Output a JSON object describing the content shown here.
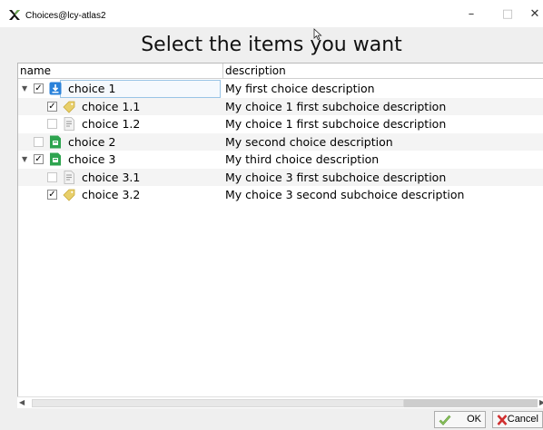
{
  "window": {
    "title": "Choices@lcy-atlas2",
    "min_glyph": "–",
    "max_glyph": "□",
    "close_glyph": "✕"
  },
  "heading": "Select the items you want",
  "columns": {
    "name": "name",
    "description": "description"
  },
  "rows": [
    {
      "name": "choice 1",
      "description": "My first choice description",
      "checked": true,
      "level": 0,
      "expandable": true,
      "icon": "download-icon",
      "selected": true
    },
    {
      "name": "choice 1.1",
      "description": "My choice 1 first subchoice description",
      "checked": true,
      "level": 1,
      "expandable": false,
      "icon": "tag-icon"
    },
    {
      "name": "choice 1.2",
      "description": "My choice 1 first subchoice description",
      "checked": false,
      "level": 1,
      "expandable": false,
      "icon": "document-icon"
    },
    {
      "name": "choice 2",
      "description": "My second choice description",
      "checked": false,
      "level": 0,
      "expandable": false,
      "icon": "green-file-icon"
    },
    {
      "name": "choice 3",
      "description": "My third choice description",
      "checked": true,
      "level": 0,
      "expandable": true,
      "icon": "green-file-icon"
    },
    {
      "name": "choice 3.1",
      "description": "My choice 3 first subchoice description",
      "checked": false,
      "level": 1,
      "expandable": false,
      "icon": "document-icon"
    },
    {
      "name": "choice 3.2",
      "description": "My choice 3 second subchoice description",
      "checked": true,
      "level": 1,
      "expandable": false,
      "icon": "tag-icon"
    }
  ],
  "glyphs": {
    "check": "✓",
    "expanded": "▼",
    "scroll_left": "◀",
    "scroll_right": "▶"
  },
  "buttons": {
    "ok": "OK",
    "cancel": "Cancel"
  },
  "colors": {
    "accent_blue": "#2a82da",
    "file_green": "#2ea44f",
    "tag_yellow": "#e8cf6a",
    "selection_border": "#99c4e6",
    "cancel_red": "#d03030"
  }
}
